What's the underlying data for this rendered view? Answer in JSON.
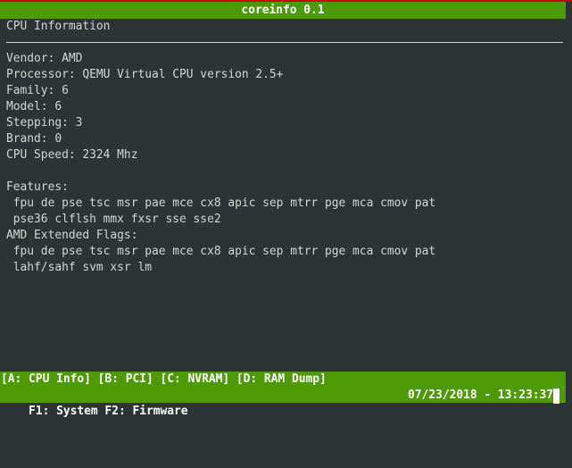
{
  "title": "coreinfo 0.1",
  "section_title": "CPU Information",
  "info": [
    "Vendor: AMD",
    "Processor: QEMU Virtual CPU version 2.5+",
    "Family: 6",
    "Model: 6",
    "Stepping: 3",
    "Brand: 0",
    "CPU Speed: 2324 Mhz"
  ],
  "features_label": "Features:",
  "features": [
    " fpu de pse tsc msr pae mce cx8 apic sep mtrr pge mca cmov pat",
    " pse36 clflsh mmx fxsr sse sse2"
  ],
  "amd_label": "AMD Extended Flags:",
  "amd_flags": [
    " fpu de pse tsc msr pae mce cx8 apic sep mtrr pge mca cmov pat",
    " lahf/sahf svm xsr lm"
  ],
  "footer": {
    "menu": "[A: CPU Info] [B: PCI] [C: NVRAM] [D: RAM Dump]",
    "fkeys": "F1: System F2: Firmware",
    "datetime": "07/23/2018 - 13:23:37"
  },
  "colors": {
    "bar": "#4e9a06",
    "background": "#2e3436",
    "text": "#d3d7cf"
  }
}
